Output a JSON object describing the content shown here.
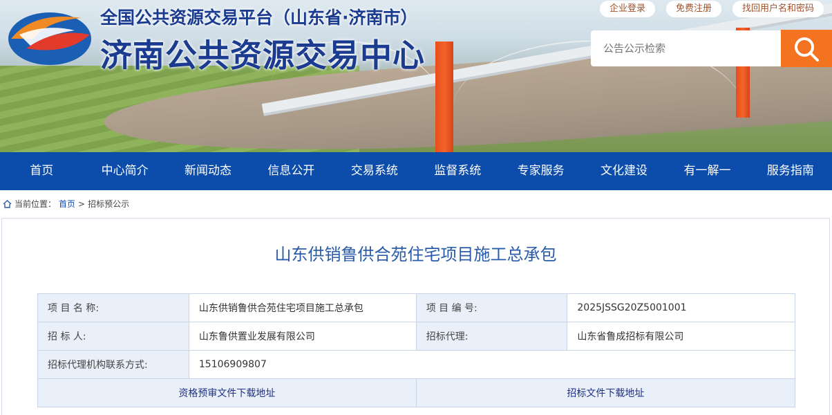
{
  "header": {
    "subtitle": "全国公共资源交易平台（山东省·济南市）",
    "title": "济南公共资源交易中心",
    "top_links": [
      "企业登录",
      "免费注册",
      "找回用户名和密码"
    ],
    "search_placeholder": "公告公示检索",
    "icons": {
      "search": "search-icon",
      "logo": "logo-icon"
    },
    "colors": {
      "brand_blue": "#1a3b8f",
      "accent_orange": "#f47321"
    }
  },
  "nav": {
    "items": [
      "首页",
      "中心简介",
      "新闻动态",
      "信息公开",
      "交易系统",
      "监督系统",
      "专家服务",
      "文化建设",
      "有一解一",
      "服务指南"
    ],
    "color": "#0c4dab"
  },
  "breadcrumb": {
    "icon": "home-icon",
    "prefix": "当前位置：",
    "home": "首页",
    "separator": ">",
    "current": "招标预公示"
  },
  "main": {
    "title": "山东供销鲁供合苑住宅项目施工总承包",
    "rows": [
      {
        "label1": "项 目 名 称:",
        "value1": "山东供销鲁供合苑住宅项目施工总承包",
        "label2": "项 目 编 号:",
        "value2": "2025JSSG20Z5001001"
      },
      {
        "label1": "招 标 人:",
        "value1": "山东鲁供置业发展有限公司",
        "label2": "招标代理:",
        "value2": "山东省鲁成招标有限公司"
      },
      {
        "label1": "招标代理机构联系方式:",
        "value1": "15106909807"
      }
    ],
    "downloads": [
      "资格预审文件下载地址",
      "招标文件下载地址"
    ]
  }
}
